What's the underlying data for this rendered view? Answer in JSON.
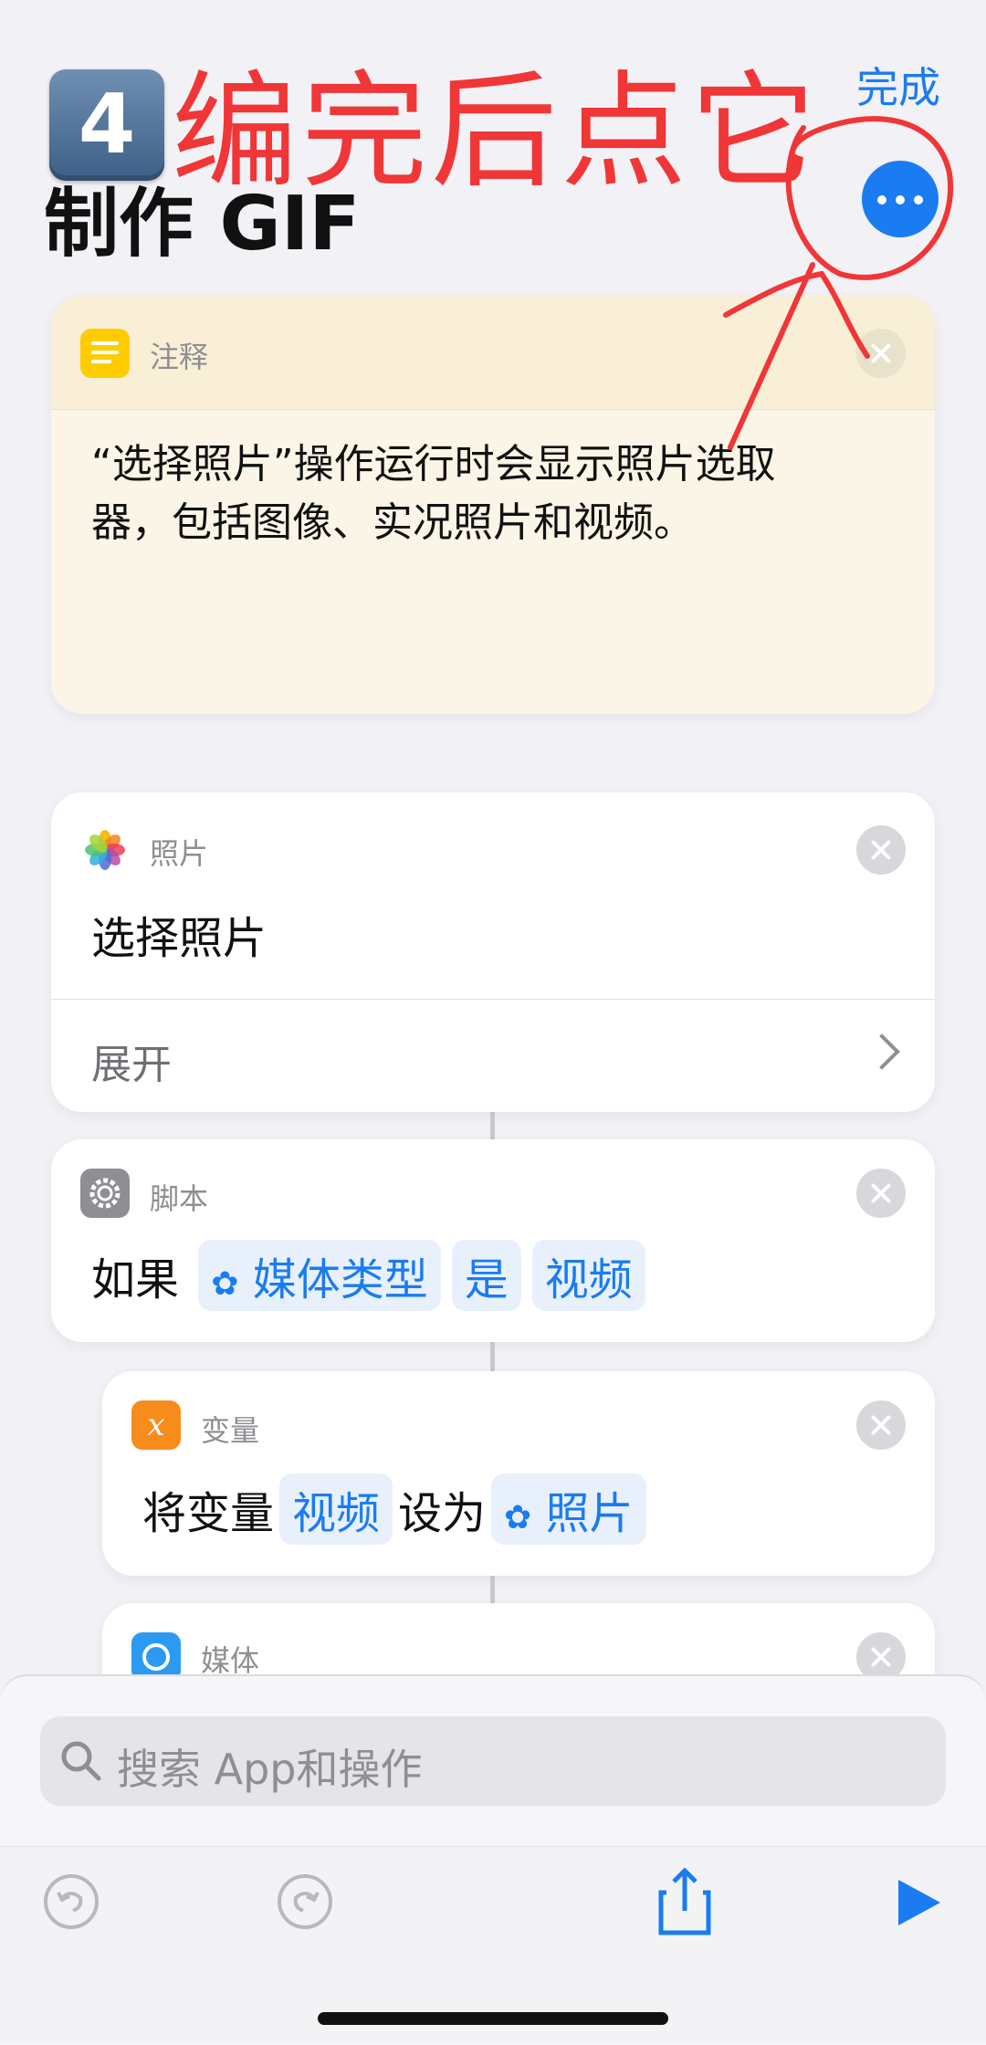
{
  "header": {
    "done_label": "完成",
    "step_number": "4",
    "annotation_text": "编完后点它",
    "title": "制作 GIF"
  },
  "cards": {
    "comment": {
      "category": "注释",
      "text_line1": "“选择照片”操作运行时会显示照片选取",
      "text_line2": "器，包括图像、实况照片和视频。"
    },
    "photos": {
      "category": "照片",
      "action": "选择照片",
      "expand": "展开"
    },
    "script": {
      "category": "脚本",
      "if_label": "如果",
      "media_type": "媒体类型",
      "is": "是",
      "video": "视频"
    },
    "variable": {
      "category": "变量",
      "set_label": "将变量",
      "var_name": "视频",
      "to_label": "设为",
      "value": "照片"
    },
    "media": {
      "category": "媒体"
    }
  },
  "search": {
    "placeholder": "搜索 App和操作"
  },
  "toolbar": {
    "undo": "undo-icon",
    "redo": "redo-icon",
    "share": "share-icon",
    "play": "play-icon"
  },
  "colors": {
    "accent": "#1a7cf0",
    "annotation": "#f03636",
    "comment_header": "#f8efd6",
    "comment_body": "#faf5e6"
  }
}
